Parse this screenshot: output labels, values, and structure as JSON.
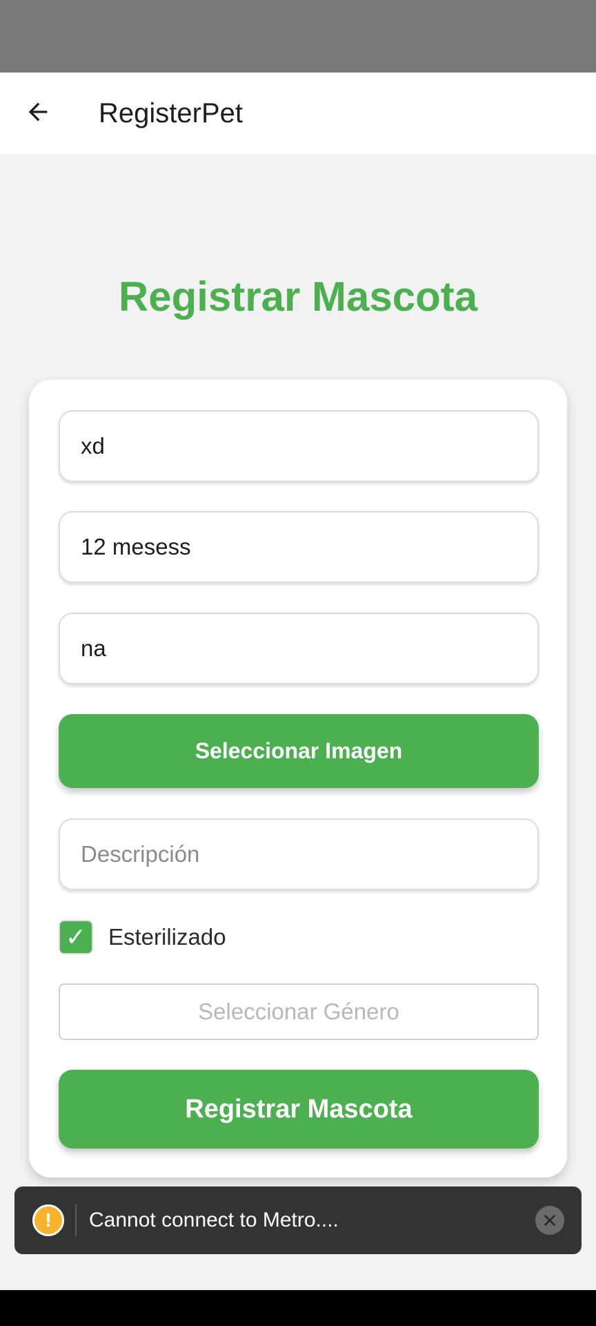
{
  "app_bar": {
    "title": "RegisterPet"
  },
  "heading": "Registrar Mascota",
  "form": {
    "name_value": "xd",
    "age_value": "12 mesess",
    "breed_value": "na",
    "select_image_label": "Seleccionar Imagen",
    "description_placeholder": "Descripción",
    "description_value": "",
    "sterilized_label": "Esterilizado",
    "sterilized_checked": true,
    "checkmark": "✓",
    "gender_placeholder": "Seleccionar Género",
    "submit_label": "Registrar Mascota"
  },
  "toast": {
    "icon_glyph": "!",
    "message": "Cannot connect to Metro...."
  },
  "colors": {
    "accent": "#4caf50",
    "status_bar": "#7a7a7a",
    "toast_bg": "#333333",
    "warning": "#f9b32f"
  },
  "icons": {
    "back": "arrow-left-icon",
    "check": "checkmark-icon",
    "warning": "warning-icon",
    "close": "close-icon"
  }
}
